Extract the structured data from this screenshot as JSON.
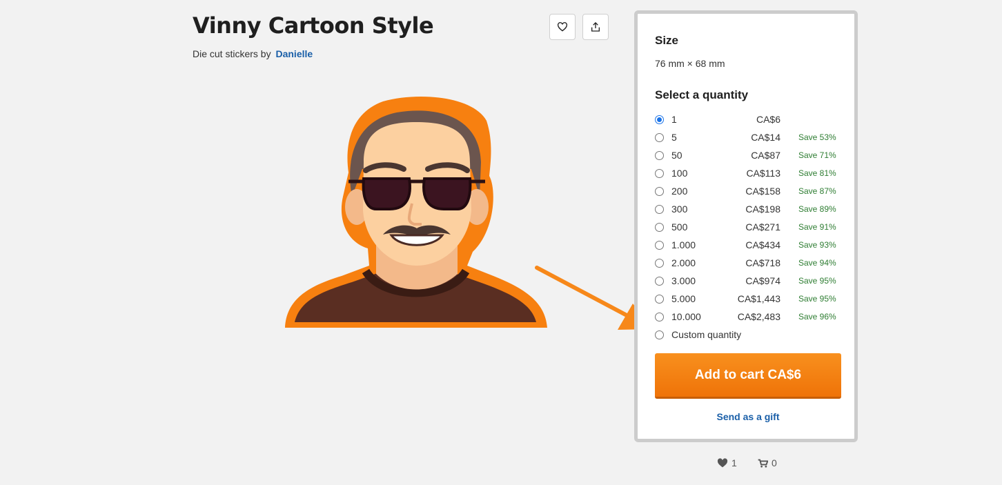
{
  "product": {
    "title": "Vinny Cartoon Style",
    "byline_prefix": "Die cut stickers by",
    "artist": "Danielle"
  },
  "actions": {
    "favorite_icon": "heart-outline-icon",
    "share_icon": "share-upload-icon"
  },
  "panel": {
    "size_heading": "Size",
    "size_value": "76 mm × 68 mm",
    "quantity_heading": "Select a quantity",
    "quantities": [
      {
        "qty": "1",
        "price": "CA$6",
        "save": "",
        "selected": true
      },
      {
        "qty": "5",
        "price": "CA$14",
        "save": "Save 53%"
      },
      {
        "qty": "50",
        "price": "CA$87",
        "save": "Save 71%"
      },
      {
        "qty": "100",
        "price": "CA$113",
        "save": "Save 81%"
      },
      {
        "qty": "200",
        "price": "CA$158",
        "save": "Save 87%"
      },
      {
        "qty": "300",
        "price": "CA$198",
        "save": "Save 89%"
      },
      {
        "qty": "500",
        "price": "CA$271",
        "save": "Save 91%"
      },
      {
        "qty": "1.000",
        "price": "CA$434",
        "save": "Save 93%"
      },
      {
        "qty": "2.000",
        "price": "CA$718",
        "save": "Save 94%"
      },
      {
        "qty": "3.000",
        "price": "CA$974",
        "save": "Save 95%"
      },
      {
        "qty": "5.000",
        "price": "CA$1,443",
        "save": "Save 95%"
      },
      {
        "qty": "10.000",
        "price": "CA$2,483",
        "save": "Save 96%"
      },
      {
        "qty": "Custom quantity",
        "price": "",
        "save": ""
      }
    ],
    "add_to_cart": "Add to cart CA$6",
    "send_gift": "Send as a gift"
  },
  "stats": {
    "likes": "1",
    "cart_count": "0"
  },
  "colors": {
    "accent": "#f7881a",
    "link": "#1a5fa8",
    "save_green": "#2e7d32"
  }
}
